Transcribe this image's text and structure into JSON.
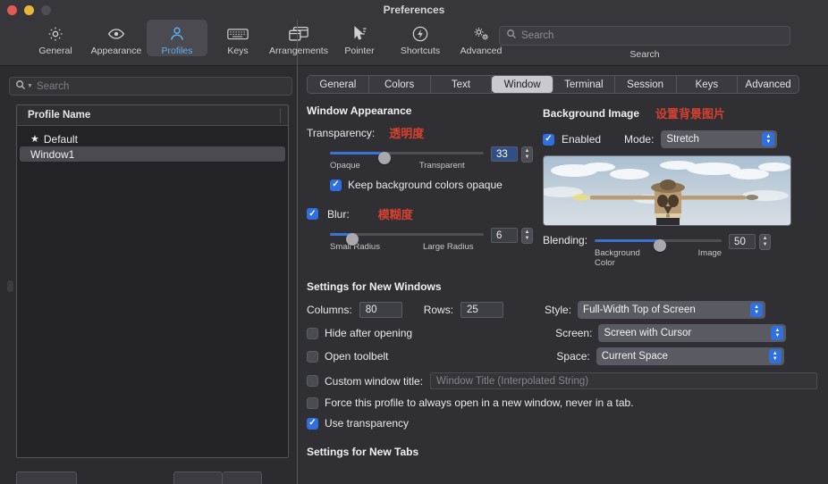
{
  "window": {
    "title": "Preferences"
  },
  "toolbar": {
    "items": [
      {
        "label": "General",
        "icon": "gear-icon"
      },
      {
        "label": "Appearance",
        "icon": "eye-icon"
      },
      {
        "label": "Profiles",
        "icon": "person-icon"
      },
      {
        "label": "Keys",
        "icon": "keyboard-icon"
      },
      {
        "label": "Arrangements",
        "icon": "windows-icon"
      },
      {
        "label": "Pointer",
        "icon": "cursor-icon"
      },
      {
        "label": "Shortcuts",
        "icon": "bolt-icon"
      },
      {
        "label": "Advanced",
        "icon": "gears-icon"
      }
    ],
    "selected": "Profiles",
    "search_placeholder": "Search",
    "search_value": "",
    "search_caption": "Search"
  },
  "sidebar": {
    "search_placeholder": "Search",
    "search_value": "",
    "table_header": "Profile Name",
    "profiles": [
      {
        "name": "Default",
        "starred": true,
        "selected": false,
        "star": "★"
      },
      {
        "name": "Window1",
        "starred": false,
        "selected": true,
        "star": ""
      }
    ]
  },
  "tabs": {
    "items": [
      "General",
      "Colors",
      "Text",
      "Window",
      "Terminal",
      "Session",
      "Keys",
      "Advanced"
    ],
    "active": "Window"
  },
  "window_appearance": {
    "section_title": "Window Appearance",
    "transparency_label": "Transparency:",
    "transparency_annotation": "透明度",
    "transparency_value": "33",
    "transparency_min_label": "Opaque",
    "transparency_max_label": "Transparent",
    "transparency_percent": 33,
    "keep_opaque_label": "Keep background colors opaque",
    "keep_opaque_checked": true,
    "blur_label": "Blur:",
    "blur_annotation": "模糊度",
    "blur_checked": true,
    "blur_value": "6",
    "blur_min_label": "Small Radius",
    "blur_max_label": "Large Radius",
    "blur_percent": 12
  },
  "background_image": {
    "section_title": "Background Image",
    "annotation": "设置背景图片",
    "enabled_label": "Enabled",
    "enabled_checked": true,
    "mode_label": "Mode:",
    "mode_value": "Stretch",
    "blending_label": "Blending:",
    "blending_value": "50",
    "blending_min_label": "Background Color",
    "blending_max_label": "Image",
    "blending_percent": 50
  },
  "new_windows": {
    "section_title": "Settings for New Windows",
    "columns_label": "Columns:",
    "columns_value": "80",
    "rows_label": "Rows:",
    "rows_value": "25",
    "style_label": "Style:",
    "style_value": "Full-Width Top of Screen",
    "screen_label": "Screen:",
    "screen_value": "Screen with Cursor",
    "space_label": "Space:",
    "space_value": "Current Space",
    "checkboxes": [
      {
        "label": "Hide after opening",
        "checked": false
      },
      {
        "label": "Open toolbelt",
        "checked": false
      }
    ],
    "custom_title_label": "Custom window title:",
    "custom_title_checked": false,
    "custom_title_placeholder": "Window Title (Interpolated String)",
    "force_new_window_label": "Force this profile to always open in a new window, never in a tab.",
    "force_new_window_checked": false,
    "use_transparency_label": "Use transparency",
    "use_transparency_checked": true
  },
  "new_tabs": {
    "section_title": "Settings for New Tabs"
  },
  "colors": {
    "accent": "#2f6fe0",
    "annotation_red": "#d6402f",
    "slider_fill": "#3b72d4",
    "selected_tab_bg": "#c9c9cf"
  }
}
